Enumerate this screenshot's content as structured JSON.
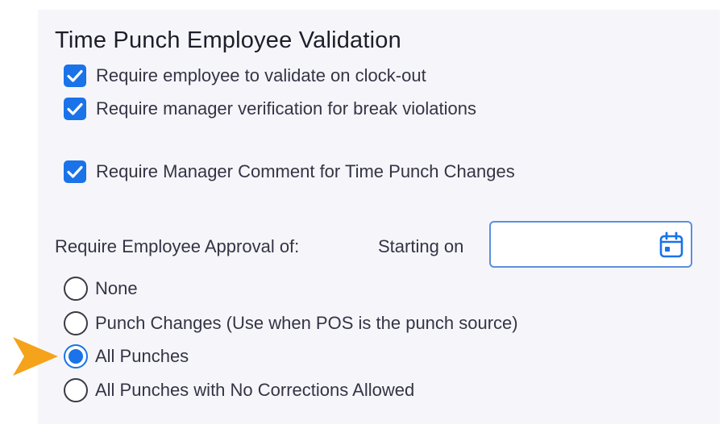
{
  "section": {
    "title": "Time Punch Employee Validation"
  },
  "checkboxes": [
    {
      "label": "Require employee to validate on clock-out",
      "checked": true
    },
    {
      "label": "Require manager verification for break violations",
      "checked": true
    },
    {
      "label": "Require Manager Comment for Time Punch Changes",
      "checked": true
    }
  ],
  "approval": {
    "label": "Require Employee Approval of:",
    "starting_label": "Starting on",
    "date_value": "",
    "options": [
      {
        "label": "None",
        "selected": false
      },
      {
        "label": "Punch Changes (Use when POS is the punch source)",
        "selected": false
      },
      {
        "label": "All Punches",
        "selected": true
      },
      {
        "label": "All Punches with No Corrections Allowed",
        "selected": false
      }
    ]
  },
  "colors": {
    "accent": "#1a73e8",
    "panel_background": "#f6f6fa",
    "pointer_arrow": "#f5a31a"
  },
  "icons": {
    "checkbox_mark": "checkmark-icon",
    "date_picker": "calendar-icon",
    "annotation": "arrow-pointer-icon"
  }
}
